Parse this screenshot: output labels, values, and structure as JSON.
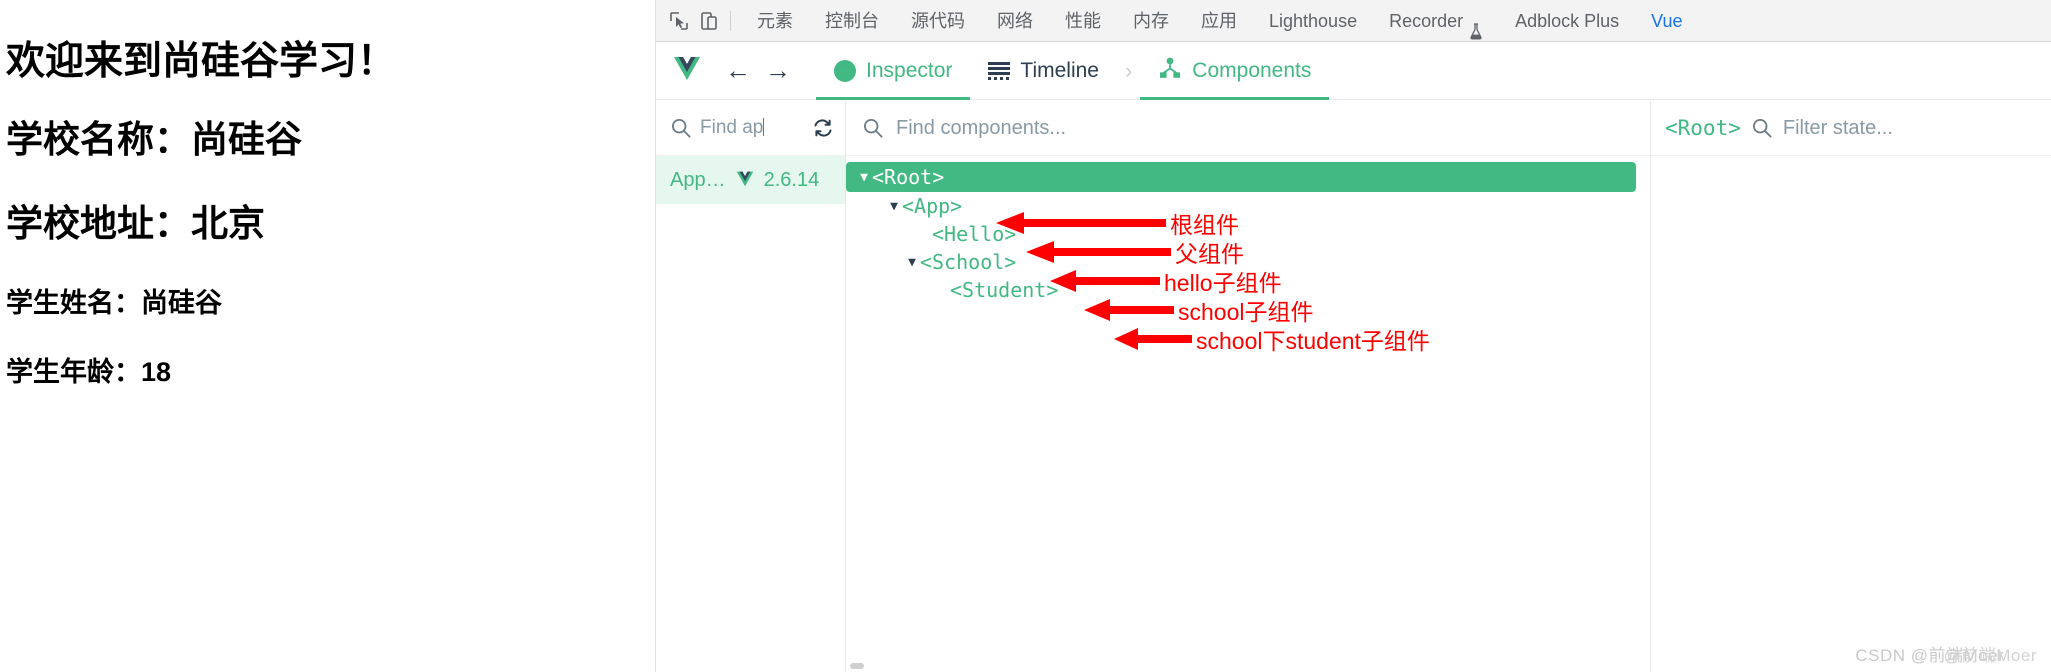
{
  "page": {
    "lines": [
      {
        "text": "欢迎来到尚硅谷学习！",
        "size": "h1"
      },
      {
        "text": "学校名称：尚硅谷",
        "size": "h2"
      },
      {
        "text": "学校地址：北京",
        "size": "h3"
      },
      {
        "text": "学生姓名：尚硅谷",
        "size": "h4"
      },
      {
        "text": "学生年龄：18",
        "size": "h5"
      }
    ]
  },
  "devtools": {
    "icons": {
      "inspect": "cursor-select-icon",
      "device": "device-toolbar-icon"
    },
    "tabs": [
      {
        "label": "元素",
        "active": false
      },
      {
        "label": "控制台",
        "active": false
      },
      {
        "label": "源代码",
        "active": false
      },
      {
        "label": "网络",
        "active": false
      },
      {
        "label": "性能",
        "active": false
      },
      {
        "label": "内存",
        "active": false
      },
      {
        "label": "应用",
        "active": false
      },
      {
        "label": "Lighthouse",
        "active": false
      },
      {
        "label": "Recorder",
        "active": false,
        "badge": "flask-icon"
      },
      {
        "label": "Adblock Plus",
        "active": false
      },
      {
        "label": "Vue",
        "active": true
      }
    ]
  },
  "vue_devtools": {
    "logo": "vue-logo-icon",
    "nav": {
      "back": "←",
      "forward": "→"
    },
    "tabs": [
      {
        "label": "Inspector",
        "icon": "compass-icon",
        "active": true
      },
      {
        "label": "Timeline",
        "icon": "timeline-icon",
        "active": false
      },
      {
        "label": "Components",
        "icon": "component-tree-icon",
        "active": true
      }
    ],
    "chevron": "›",
    "app_panel": {
      "search_placeholder": "Find ap",
      "refresh_icon": "refresh-icon",
      "selected_app": {
        "name": "App…",
        "logo": "vue-logo-icon",
        "version": "2.6.14"
      }
    },
    "component_panel": {
      "search_placeholder": "Find components...",
      "tree": [
        {
          "tag": "<Root>",
          "depth": 1,
          "expandable": true,
          "expanded": true,
          "selected": true
        },
        {
          "tag": "<App>",
          "depth": 2,
          "expandable": true,
          "expanded": true,
          "selected": false
        },
        {
          "tag": "<Hello>",
          "depth": 3,
          "expandable": false,
          "expanded": false,
          "selected": false
        },
        {
          "tag": "<School>",
          "depth": 4,
          "expandable": true,
          "expanded": true,
          "selected": false
        },
        {
          "tag": "<Student>",
          "depth": 5,
          "expandable": false,
          "expanded": false,
          "selected": false
        }
      ]
    },
    "state_panel": {
      "component_tag": "<Root>",
      "filter_placeholder": "Filter state...",
      "search_icon": "search-icon"
    }
  },
  "annotations": [
    {
      "note": "根组件",
      "target": "<Root>"
    },
    {
      "note": "父组件",
      "target": "<App>"
    },
    {
      "note": "hello子组件",
      "target": "<Hello>"
    },
    {
      "note": "school子组件",
      "target": "<School>"
    },
    {
      "note": "school下student子组件",
      "target": "<Student>"
    }
  ],
  "watermark": {
    "brand": "CSDN",
    "user": "@前端Moer"
  },
  "colors": {
    "vue_green": "#42b883",
    "vue_dark": "#2c3e50",
    "annotation_red": "#ff0000",
    "chrome_tab_active": "#1a73e8",
    "selected_row_bg": "#42b883",
    "app_row_bg": "#e6f7ef"
  }
}
